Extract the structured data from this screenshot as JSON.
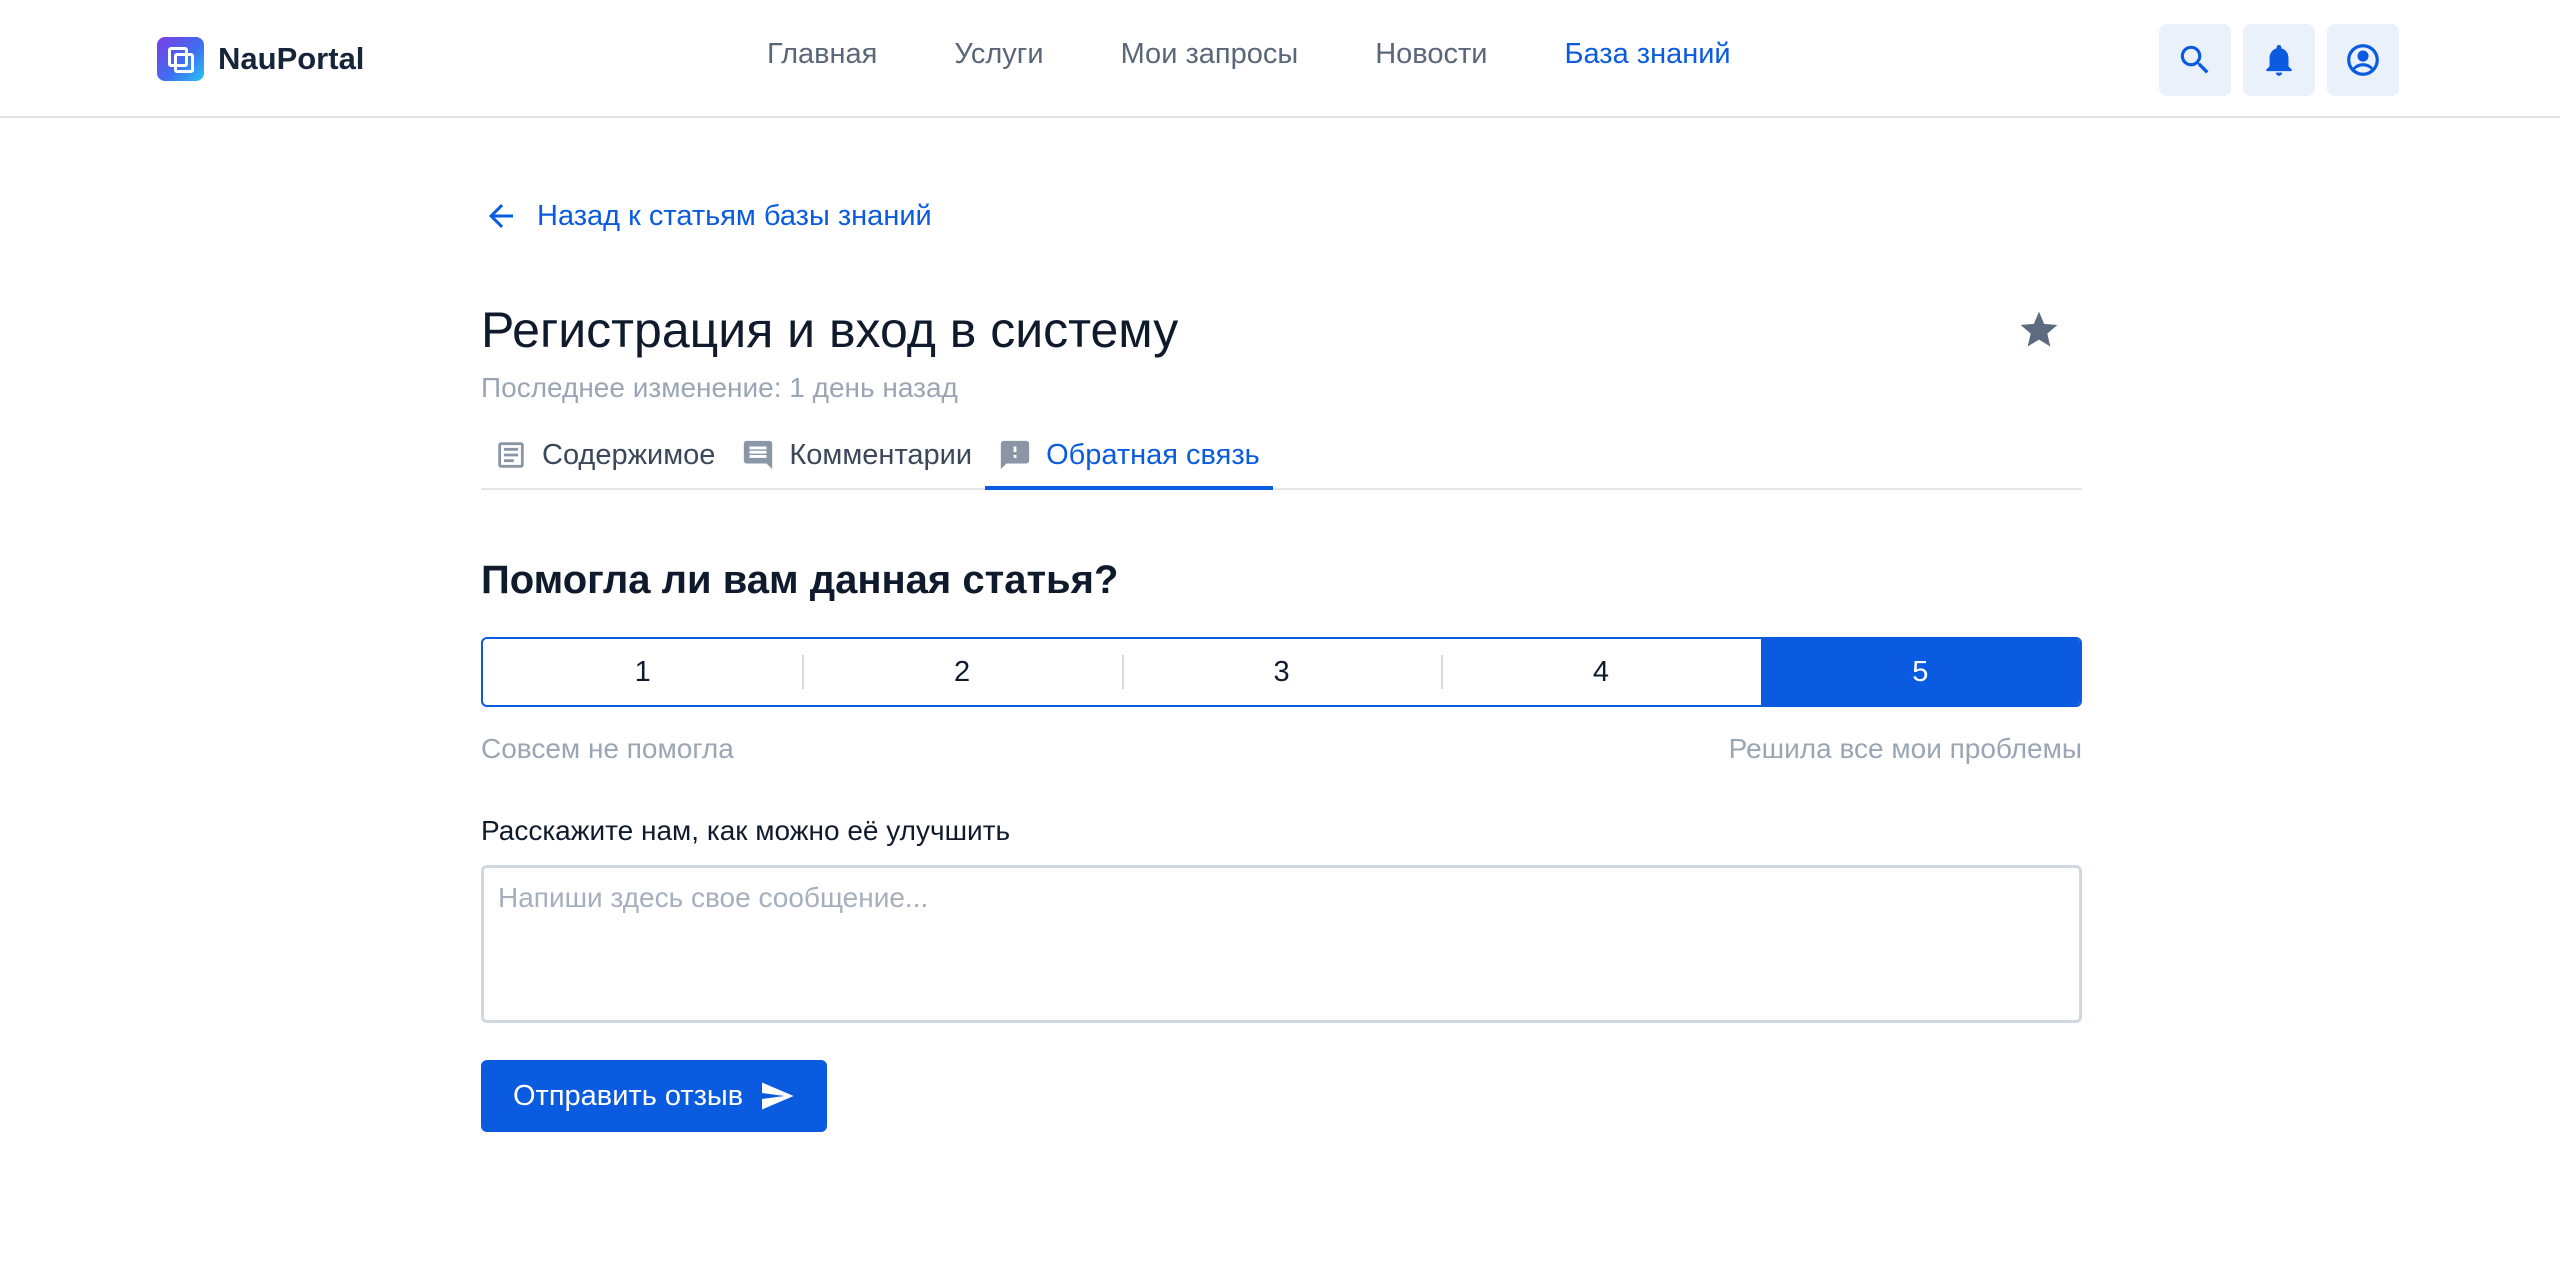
{
  "brand": {
    "name": "NauPortal"
  },
  "nav": {
    "items": [
      {
        "label": "Главная"
      },
      {
        "label": "Услуги"
      },
      {
        "label": "Мои запросы"
      },
      {
        "label": "Новости"
      },
      {
        "label": "База знаний",
        "active": true
      }
    ]
  },
  "header_icons": [
    "search-icon",
    "bell-icon",
    "account-icon"
  ],
  "back": {
    "label": "Назад к статьям базы знаний"
  },
  "article": {
    "title": "Регистрация и вход в систему",
    "last_modified": "Последнее изменение: 1 день назад"
  },
  "tabs": [
    {
      "label": "Содержимое",
      "icon": "article-icon"
    },
    {
      "label": "Комментарии",
      "icon": "comment-icon"
    },
    {
      "label": "Обратная связь",
      "icon": "feedback-icon",
      "active": true
    }
  ],
  "feedback": {
    "question": "Помогла ли вам данная статья?",
    "options": [
      "1",
      "2",
      "3",
      "4",
      "5"
    ],
    "selected": "5",
    "min_label": "Совсем не помогла",
    "max_label": "Решила все мои проблемы",
    "improve_label": "Расскажите нам, как можно её улучшить",
    "message_value": "",
    "message_placeholder": "Напиши здесь свое сообщение...",
    "submit_label": "Отправить отзыв"
  },
  "colors": {
    "accent": "#0a5be0",
    "muted_text": "#9aa6b4",
    "icon_bg": "#eaf1fb"
  }
}
